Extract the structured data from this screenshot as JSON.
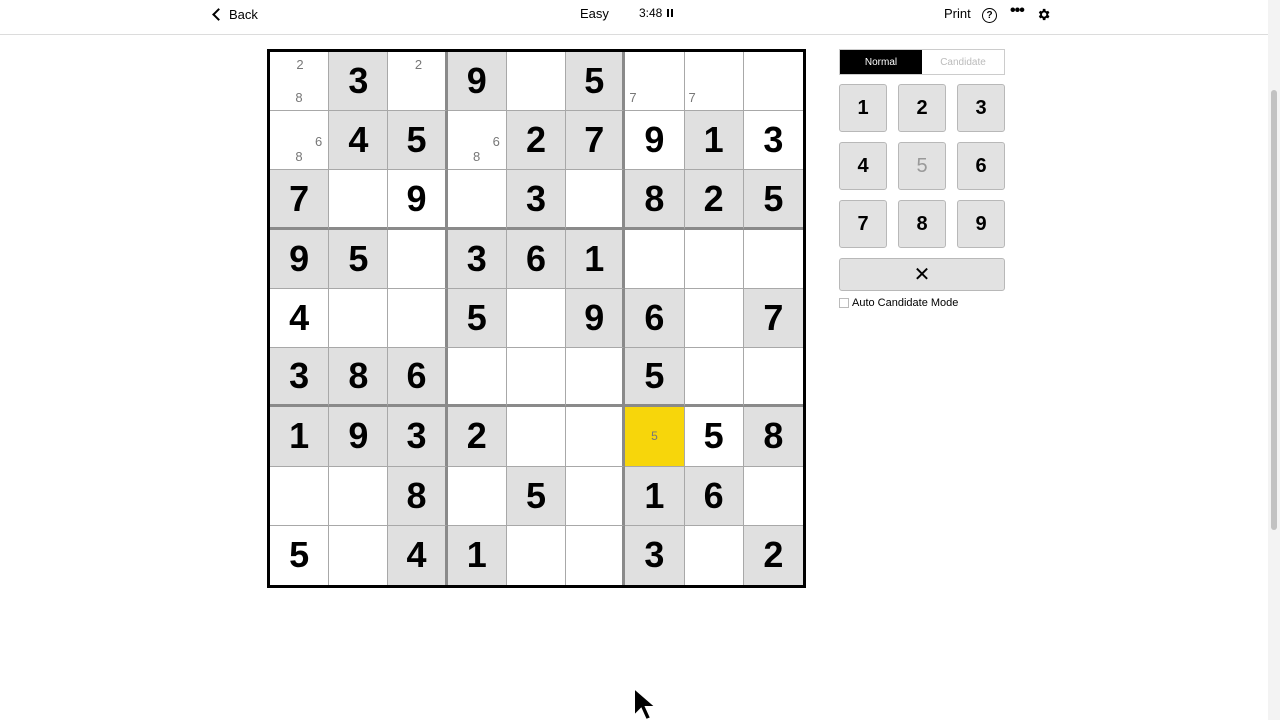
{
  "header": {
    "back_label": "Back",
    "difficulty": "Easy",
    "timer": "3:48",
    "print_label": "Print",
    "help_label": "?",
    "more_label": "•••"
  },
  "mode": {
    "normal_label": "Normal",
    "candidate_label": "Candidate",
    "active": "Normal"
  },
  "keypad": {
    "keys": [
      {
        "label": "1",
        "disabled": false
      },
      {
        "label": "2",
        "disabled": false
      },
      {
        "label": "3",
        "disabled": false
      },
      {
        "label": "4",
        "disabled": false
      },
      {
        "label": "5",
        "disabled": true
      },
      {
        "label": "6",
        "disabled": false
      },
      {
        "label": "7",
        "disabled": false
      },
      {
        "label": "8",
        "disabled": false
      },
      {
        "label": "9",
        "disabled": false
      }
    ],
    "erase_label": "✕",
    "auto_candidate_label": "Auto Candidate Mode",
    "auto_candidate_checked": false
  },
  "colors": {
    "given_bg": "#e0e0e0",
    "selected_bg": "#f7d60b",
    "mode_active_bg": "#000000"
  },
  "grid": {
    "rows": [
      [
        {
          "v": "",
          "cands": [
            "2",
            "8"
          ]
        },
        {
          "v": "3",
          "given": true
        },
        {
          "v": "",
          "cands": [
            "2"
          ]
        },
        {
          "v": "9",
          "given": true
        },
        {
          "v": ""
        },
        {
          "v": "5",
          "given": true
        },
        {
          "v": "",
          "cands": [
            "7"
          ]
        },
        {
          "v": "",
          "cands": [
            "7"
          ]
        },
        {
          "v": ""
        }
      ],
      [
        {
          "v": "",
          "cands": [
            "6",
            "8"
          ]
        },
        {
          "v": "4",
          "given": true
        },
        {
          "v": "5",
          "given": true
        },
        {
          "v": "",
          "cands": [
            "6",
            "8"
          ]
        },
        {
          "v": "2",
          "given": true
        },
        {
          "v": "7",
          "given": true
        },
        {
          "v": "9"
        },
        {
          "v": "1",
          "given": true
        },
        {
          "v": "3"
        }
      ],
      [
        {
          "v": "7",
          "given": true
        },
        {
          "v": ""
        },
        {
          "v": "9"
        },
        {
          "v": ""
        },
        {
          "v": "3",
          "given": true
        },
        {
          "v": ""
        },
        {
          "v": "8",
          "given": true
        },
        {
          "v": "2",
          "given": true
        },
        {
          "v": "5",
          "given": true
        }
      ],
      [
        {
          "v": "9",
          "given": true
        },
        {
          "v": "5",
          "given": true
        },
        {
          "v": ""
        },
        {
          "v": "3",
          "given": true
        },
        {
          "v": "6",
          "given": true
        },
        {
          "v": "1",
          "given": true
        },
        {
          "v": ""
        },
        {
          "v": ""
        },
        {
          "v": ""
        }
      ],
      [
        {
          "v": "4"
        },
        {
          "v": ""
        },
        {
          "v": ""
        },
        {
          "v": "5",
          "given": true
        },
        {
          "v": ""
        },
        {
          "v": "9",
          "given": true
        },
        {
          "v": "6",
          "given": true
        },
        {
          "v": ""
        },
        {
          "v": "7",
          "given": true
        }
      ],
      [
        {
          "v": "3",
          "given": true
        },
        {
          "v": "8",
          "given": true
        },
        {
          "v": "6",
          "given": true
        },
        {
          "v": ""
        },
        {
          "v": ""
        },
        {
          "v": ""
        },
        {
          "v": "5",
          "given": true
        },
        {
          "v": ""
        },
        {
          "v": ""
        }
      ],
      [
        {
          "v": "1",
          "given": true
        },
        {
          "v": "9",
          "given": true
        },
        {
          "v": "3",
          "given": true
        },
        {
          "v": "2",
          "given": true
        },
        {
          "v": ""
        },
        {
          "v": ""
        },
        {
          "v": "5",
          "selected": true,
          "small": true
        },
        {
          "v": "5"
        },
        {
          "v": "8",
          "given": true
        }
      ],
      [
        {
          "v": ""
        },
        {
          "v": ""
        },
        {
          "v": "8",
          "given": true
        },
        {
          "v": ""
        },
        {
          "v": "5",
          "given": true
        },
        {
          "v": ""
        },
        {
          "v": "1",
          "given": true
        },
        {
          "v": "6",
          "given": true
        },
        {
          "v": ""
        }
      ],
      [
        {
          "v": "5"
        },
        {
          "v": ""
        },
        {
          "v": "4",
          "given": true
        },
        {
          "v": "1",
          "given": true
        },
        {
          "v": ""
        },
        {
          "v": ""
        },
        {
          "v": "3",
          "given": true
        },
        {
          "v": ""
        },
        {
          "v": "2",
          "given": true
        }
      ]
    ]
  }
}
